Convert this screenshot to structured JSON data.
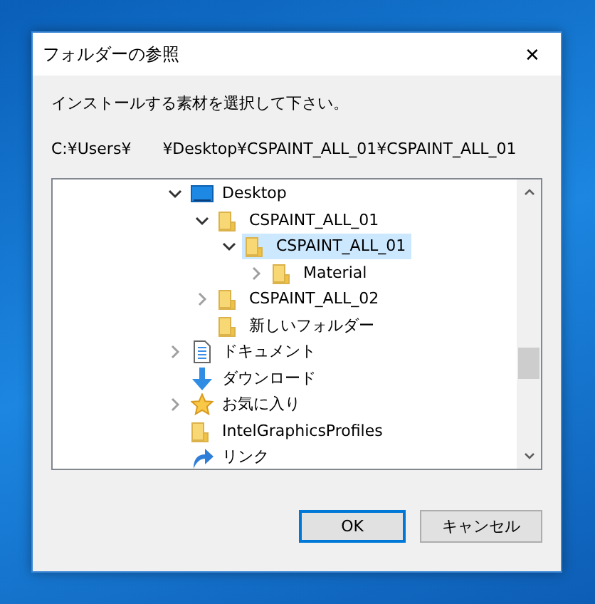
{
  "window": {
    "title": "フォルダーの参照",
    "close_glyph": "✕"
  },
  "message": "インストールする素材を選択して下さい。",
  "path": {
    "part_1": "C:¥Users¥",
    "part_2": "¥Desktop¥CSPAINT_ALL_01¥CSPAINT_ALL_01"
  },
  "tree": [
    {
      "label": "Desktop",
      "kind": "desktop",
      "expandable": true,
      "expanded": true,
      "selected": false,
      "children": [
        {
          "label": "CSPAINT_ALL_01",
          "kind": "folder",
          "expandable": true,
          "expanded": true,
          "selected": false,
          "children": [
            {
              "label": "CSPAINT_ALL_01",
              "kind": "folder",
              "expandable": true,
              "expanded": true,
              "selected": true,
              "children": [
                {
                  "label": "Material",
                  "kind": "folder",
                  "expandable": true,
                  "expanded": false,
                  "selected": false
                }
              ]
            }
          ]
        },
        {
          "label": "CSPAINT_ALL_02",
          "kind": "folder",
          "expandable": true,
          "expanded": false,
          "selected": false
        },
        {
          "label": "新しいフォルダー",
          "kind": "folder",
          "expandable": false,
          "selected": false
        }
      ]
    },
    {
      "label": "ドキュメント",
      "kind": "documents",
      "expandable": true,
      "expanded": false,
      "selected": false
    },
    {
      "label": "ダウンロード",
      "kind": "downloads",
      "expandable": false,
      "selected": false
    },
    {
      "label": "お気に入り",
      "kind": "favorites",
      "expandable": true,
      "expanded": false,
      "selected": false
    },
    {
      "label": "IntelGraphicsProfiles",
      "kind": "folder",
      "expandable": false,
      "selected": false
    },
    {
      "label": "リンク",
      "kind": "links",
      "expandable": false,
      "selected": false
    }
  ],
  "buttons": [
    {
      "label": "OK",
      "default": true
    },
    {
      "label": "キャンセル",
      "default": false
    }
  ]
}
